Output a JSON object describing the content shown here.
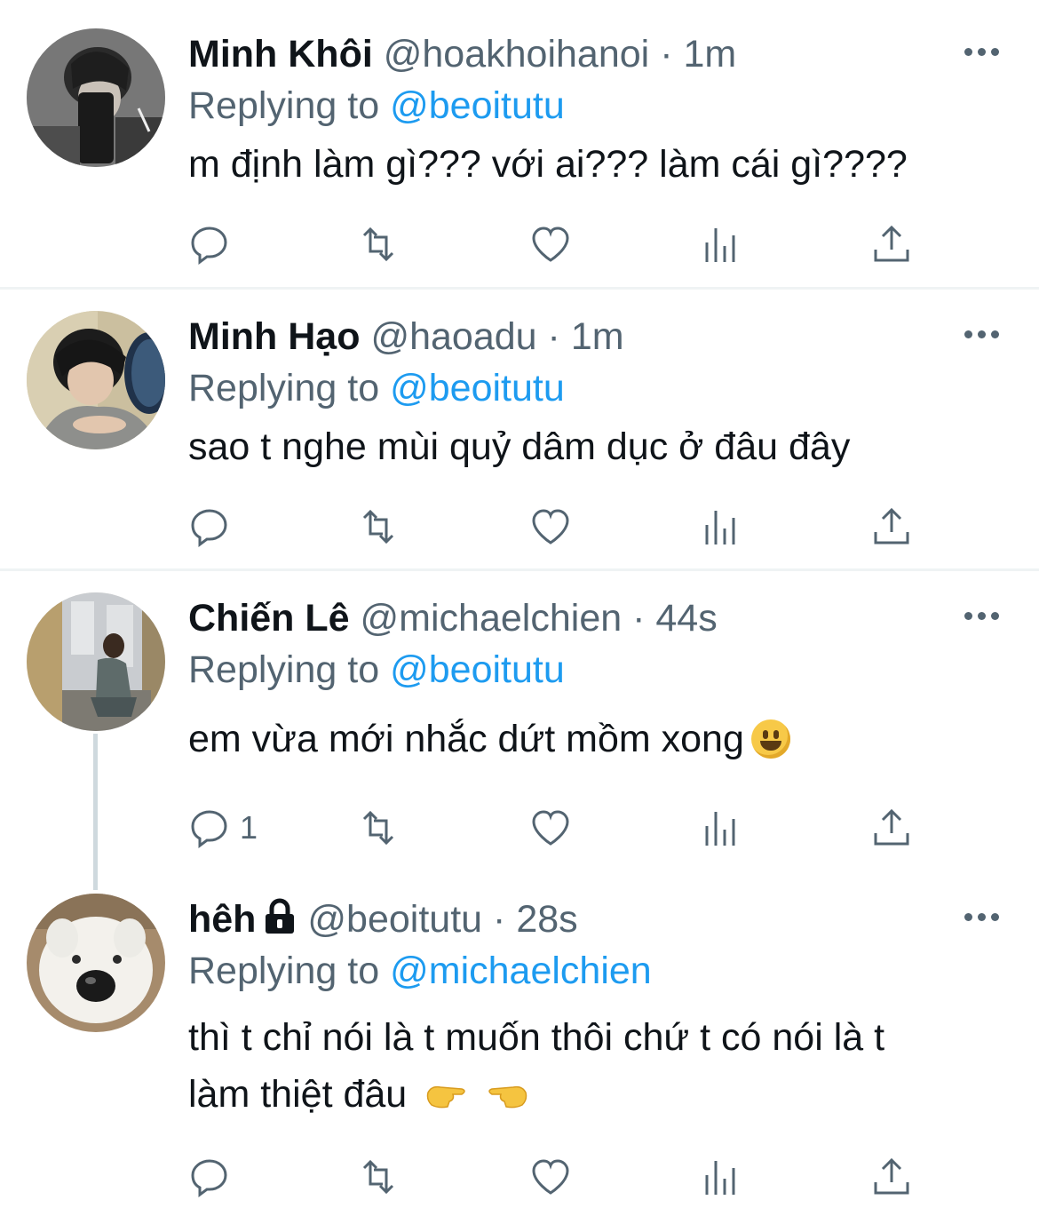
{
  "replies": [
    {
      "name": "Minh Khôi",
      "handle": "@hoakhoihanoi",
      "separator": "·",
      "time": "1m",
      "replying_label": "Replying to",
      "replying_to": "@beoitutu",
      "text": "m định làm gì??? với ai??? làm cái gì????",
      "reply_count": "",
      "avatar_icon": "avatar-photo"
    },
    {
      "name": "Minh Hạo",
      "handle": "@haoadu",
      "separator": "·",
      "time": "1m",
      "replying_label": "Replying to",
      "replying_to": "@beoitutu",
      "text": "sao t nghe mùi quỷ dâm dục ở đâu đây",
      "reply_count": "",
      "avatar_icon": "avatar-photo"
    },
    {
      "name": "Chiến Lê",
      "handle": "@michaelchien",
      "separator": "·",
      "time": "44s",
      "replying_label": "Replying to",
      "replying_to": "@beoitutu",
      "text": "em vừa mới nhắc dứt mồm xong",
      "reply_count": "1",
      "avatar_icon": "avatar-photo"
    },
    {
      "name": "hêh",
      "handle": "@beoitutu",
      "separator": "·",
      "time": "28s",
      "replying_label": "Replying to",
      "replying_to": "@michaelchien",
      "text_line1": "thì t chỉ nói là t muốn thôi chứ t có nói là t",
      "text_line2": "làm thiệt đâu",
      "reply_count": "",
      "protected_icon": "lock-icon",
      "avatar_icon": "avatar-photo"
    }
  ],
  "action_icons": [
    "reply-icon",
    "retweet-icon",
    "like-icon",
    "analytics-icon",
    "share-icon"
  ],
  "colors": {
    "link": "#1d9bf0",
    "secondary_text": "#536471",
    "primary_text": "#0f1419",
    "divider": "#eff3f4"
  }
}
